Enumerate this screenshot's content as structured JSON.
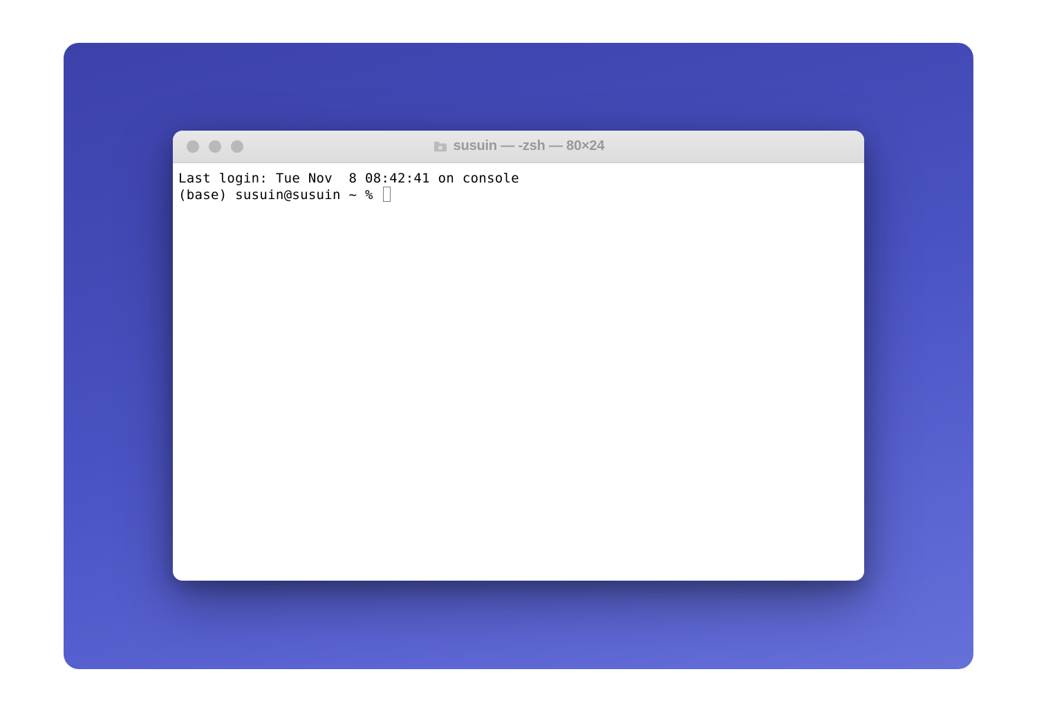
{
  "window": {
    "title": "susuin — -zsh — 80×24"
  },
  "terminal": {
    "last_login": "Last login: Tue Nov  8 08:42:41 on console",
    "prompt": "(base) susuin@susuin ~ % "
  }
}
